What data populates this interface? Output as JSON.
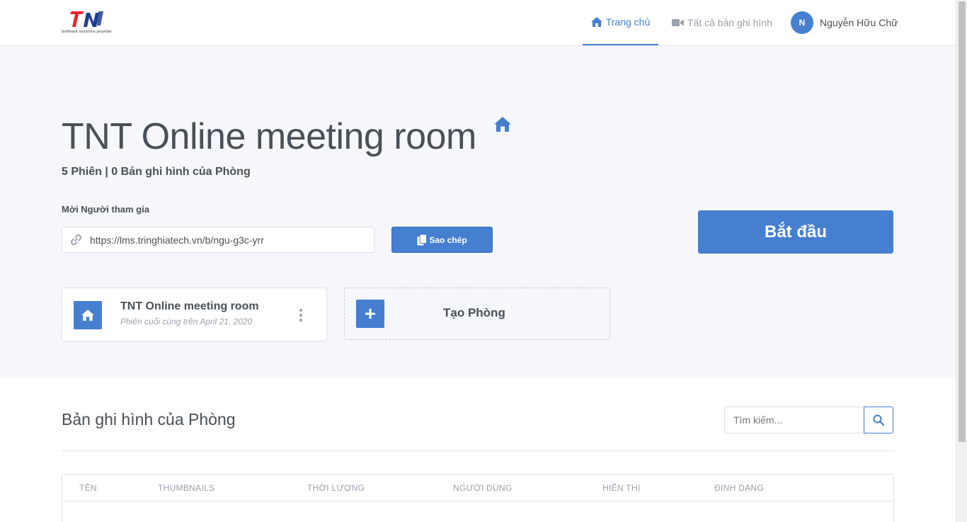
{
  "navbar": {
    "logo_tagline": "Software solutions provider",
    "home_label": "Trang chủ",
    "recordings_label": "Tất cả bản ghi hình",
    "user_initial": "N",
    "user_name": "Nguyễn Hữu Chữ"
  },
  "hero": {
    "room_title": "TNT Online meeting room",
    "stats": "5 Phiên | 0 Bản ghi hình của Phòng",
    "invite_label": "Mời Người tham gia",
    "invite_url": "https://lms.tringhiatech.vn/b/ngu-g3c-yrr",
    "copy_label": "Sao chép",
    "start_label": "Bắt đầu"
  },
  "room_card": {
    "name": "TNT Online meeting room",
    "last_session": "Phiên cuối cùng trên April 21, 2020"
  },
  "create_card": {
    "label": "Tạo Phòng"
  },
  "recordings": {
    "title": "Bản ghi hình của Phòng",
    "search_placeholder": "Tìm kiếm...",
    "columns": [
      "Tên",
      "Thumbnails",
      "Thời lượng",
      "Người dùng",
      "Hiển thị",
      "Định dạng"
    ]
  },
  "colors": {
    "primary": "#467fcf",
    "hero_bg": "#f5f7fb",
    "text": "#495057",
    "muted": "#9aa0ac",
    "logo_red": "#e0262d",
    "logo_blue": "#1e3f8f"
  },
  "icons": {
    "home": "home-icon",
    "recordings": "video-camera-icon",
    "link": "link-icon",
    "copy": "copy-icon",
    "plus": "plus-icon",
    "search": "search-icon",
    "menu": "vertical-ellipsis-icon"
  }
}
